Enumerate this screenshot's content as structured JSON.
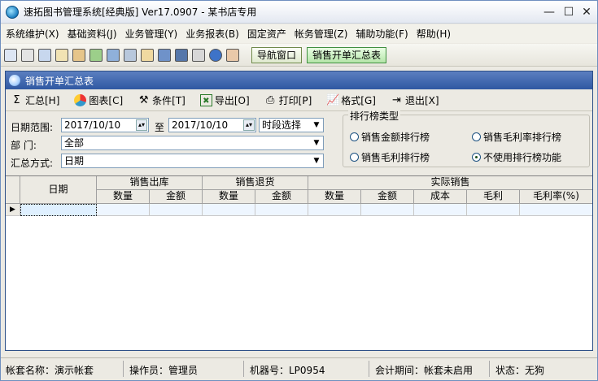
{
  "window": {
    "title": "速拓图书管理系统[经典版] Ver17.0907  -  某书店专用",
    "min": "—",
    "max": "☐",
    "close": "✕"
  },
  "menu": [
    "系统维护(X)",
    "基础资料(J)",
    "业务管理(Y)",
    "业务报表(B)",
    "固定资产",
    "帐务管理(Z)",
    "辅助功能(F)",
    "帮助(H)"
  ],
  "toolbar": {
    "nav_label": "导航窗口",
    "sales_label": "销售开单汇总表"
  },
  "subwindow": {
    "title": "销售开单汇总表",
    "actions": [
      "汇总[H]",
      "图表[C]",
      "条件[T]",
      "导出[O]",
      "打印[P]",
      "格式[G]",
      "退出[X]"
    ]
  },
  "filters": {
    "date_range_label": "日期范围:",
    "date_from": "2017/10/10",
    "to_label": "至",
    "date_to": "2017/10/10",
    "period_select": "时段选择",
    "dept_label": "部    门:",
    "dept_value": "全部",
    "summary_label": "汇总方式:",
    "summary_value": "日期"
  },
  "ranking": {
    "legend": "排行榜类型",
    "options": [
      {
        "label": "销售金额排行榜",
        "checked": false
      },
      {
        "label": "销售毛利率排行榜",
        "checked": false
      },
      {
        "label": "销售毛利排行榜",
        "checked": false
      },
      {
        "label": "不使用排行榜功能",
        "checked": true
      }
    ]
  },
  "table": {
    "date_header": "日期",
    "groups": [
      "销售出库",
      "销售退货",
      "实际销售"
    ],
    "columns": [
      "数量",
      "金额",
      "数量",
      "金额",
      "数量",
      "金额",
      "成本",
      "毛利",
      "毛利率(%)"
    ],
    "row_marker": "▶"
  },
  "status": {
    "account": "帐套名称：演示帐套",
    "operator": "操作员：管理员",
    "machine": "机器号：LP0954",
    "period": "会计期间：帐套未启用",
    "state": "状态：无狗"
  },
  "colors": {
    "title_bar": "#2f58a2",
    "sales_button": "#b5e5a9"
  }
}
